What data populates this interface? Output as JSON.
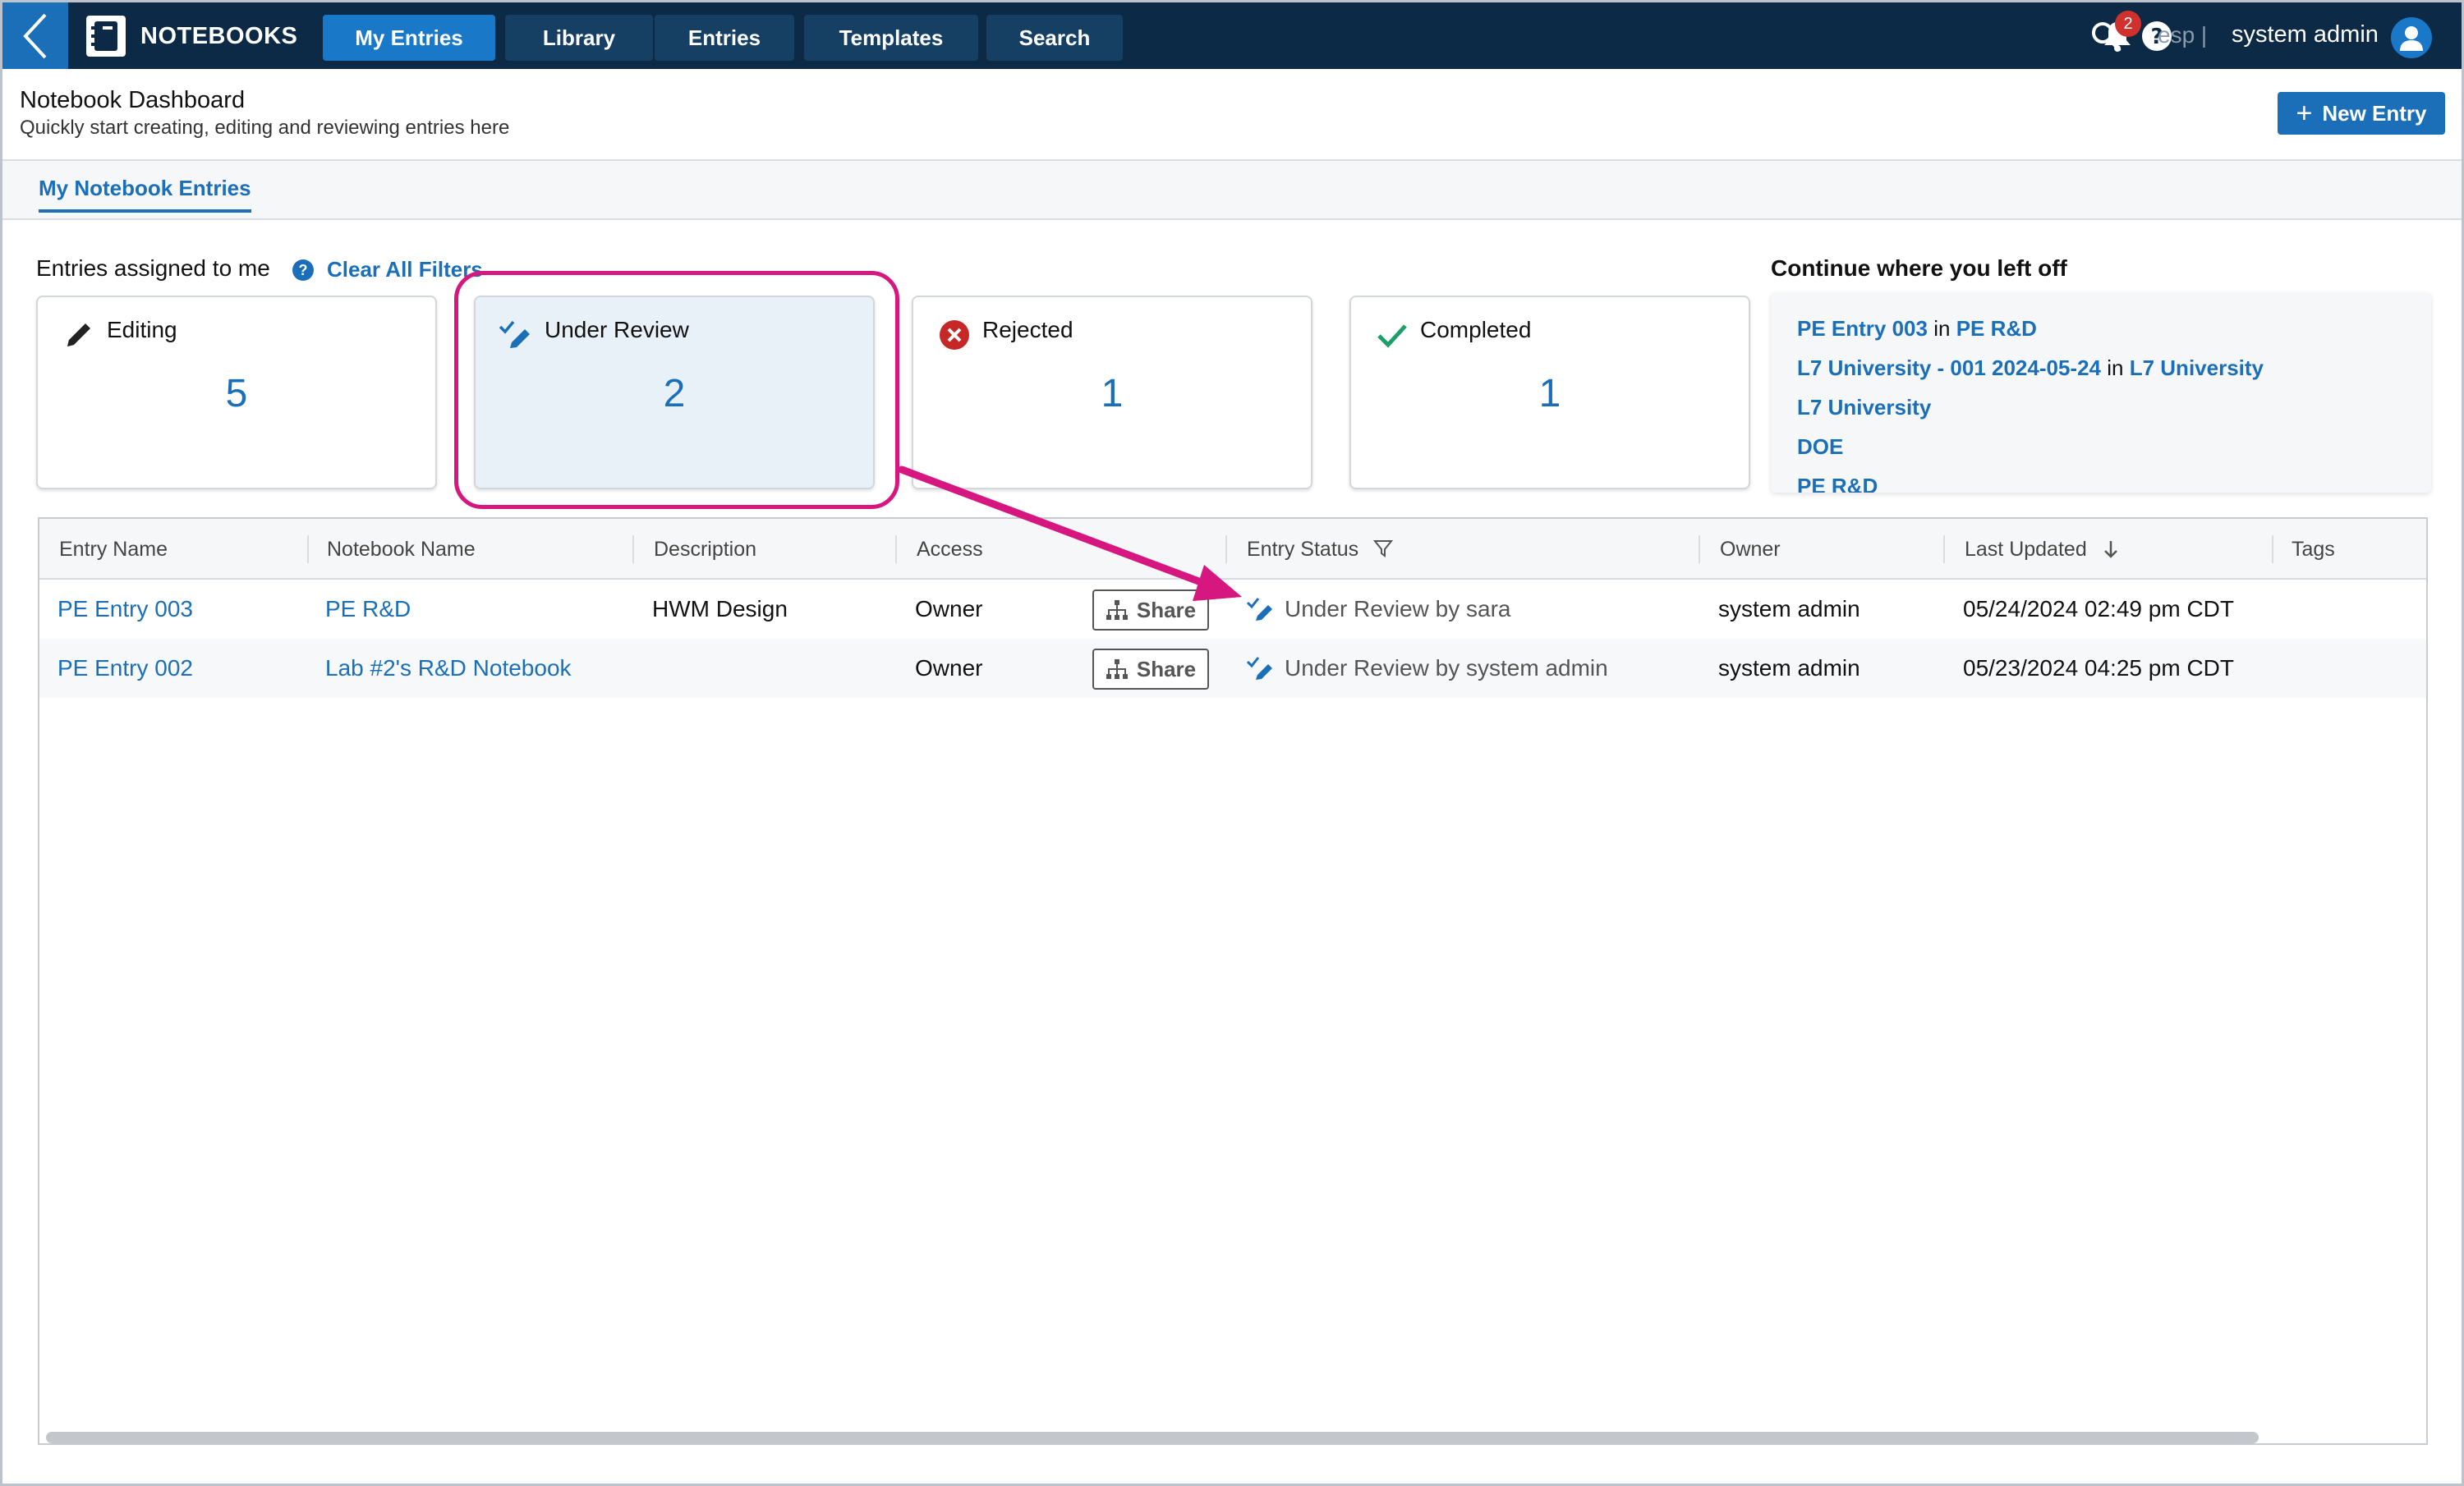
{
  "topbar": {
    "brand": "NOTEBOOKS",
    "tabs": [
      {
        "label": "My Entries",
        "active": true
      },
      {
        "label": "Library",
        "active": false
      },
      {
        "label": "Entries",
        "active": false
      },
      {
        "label": "Templates",
        "active": false
      },
      {
        "label": "Search",
        "active": false
      }
    ],
    "notification_count": "2",
    "lang": "esp |",
    "user": "system admin"
  },
  "header": {
    "title": "Notebook Dashboard",
    "subtitle": "Quickly start creating, editing and reviewing entries here",
    "new_entry_label": "New Entry"
  },
  "tabs": {
    "my_entries": "My Notebook Entries"
  },
  "assigned": {
    "label": "Entries assigned to me",
    "clear_filters": "Clear All Filters",
    "cards": [
      {
        "label": "Editing",
        "count": "5",
        "icon": "pencil-icon"
      },
      {
        "label": "Under Review",
        "count": "2",
        "icon": "review-pencil-icon",
        "selected": true
      },
      {
        "label": "Rejected",
        "count": "1",
        "icon": "rejected-x-icon"
      },
      {
        "label": "Completed",
        "count": "1",
        "icon": "check-icon"
      }
    ]
  },
  "continue": {
    "label": "Continue where you left off",
    "connector": "in",
    "items": [
      {
        "entry": "PE Entry 003",
        "notebook": "PE R&D"
      },
      {
        "entry": "L7 University - 001 2024-05-24",
        "notebook": "L7 University"
      },
      {
        "entry": "L7 University",
        "notebook": ""
      },
      {
        "entry": "DOE",
        "notebook": ""
      },
      {
        "entry": "PE R&D",
        "notebook": ""
      }
    ]
  },
  "table": {
    "columns": [
      "Entry Name",
      "Notebook Name",
      "Description",
      "Access",
      "Entry Status",
      "Owner",
      "Last Updated",
      "Tags"
    ],
    "share_label": "Share",
    "rows": [
      {
        "entry_name": "PE Entry 003",
        "notebook_name": "PE R&D",
        "description": "HWM Design",
        "access": "Owner",
        "status": "Under Review",
        "status_by": "by sara",
        "owner": "system admin",
        "last_updated": "05/24/2024 02:49 pm CDT",
        "tags": ""
      },
      {
        "entry_name": "PE Entry 002",
        "notebook_name": "Lab #2's R&D Notebook",
        "description": "",
        "access": "Owner",
        "status": "Under Review",
        "status_by": "by system admin",
        "owner": "system admin",
        "last_updated": "05/23/2024 04:25 pm CDT",
        "tags": ""
      }
    ]
  },
  "colors": {
    "nav_bg": "#0c2a45",
    "accent": "#1a6fb8",
    "highlight": "#d6177f",
    "rejected": "#c62828",
    "completed": "#1e9e6a"
  }
}
